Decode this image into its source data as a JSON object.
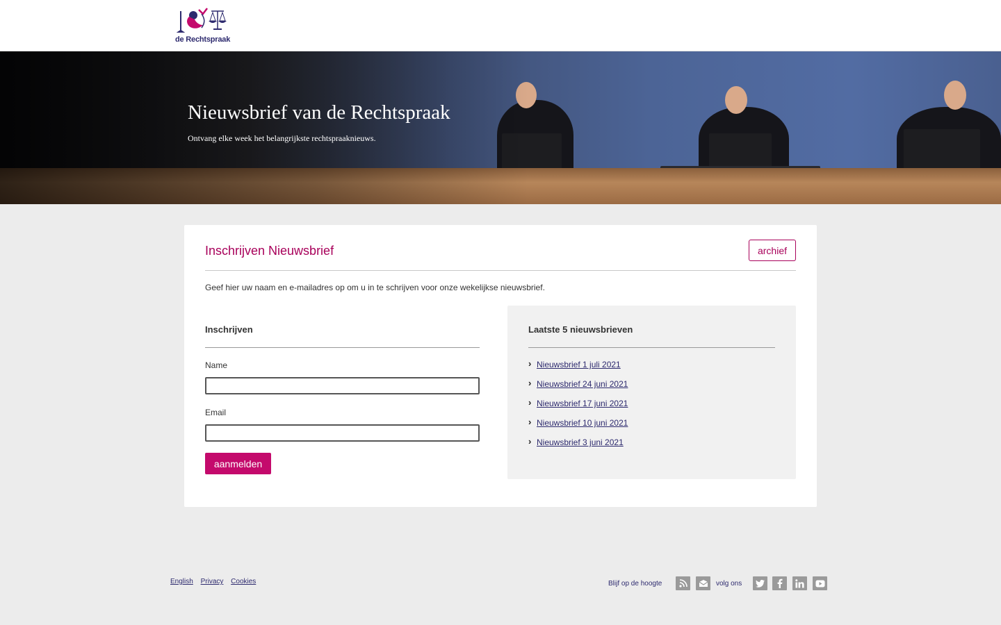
{
  "header": {
    "logo_text": "de Rechtspraak"
  },
  "hero": {
    "title": "Nieuwsbrief van de Rechtspraak",
    "subtitle": "Ontvang elke week het belangrijkste rechtspraaknieuws."
  },
  "card": {
    "title": "Inschrijven Nieuwsbrief",
    "archive_label": "archief",
    "intro": "Geef hier uw naam en e-mailadres op om u in te schrijven voor onze wekelijkse nieuwsbrief."
  },
  "form": {
    "title": "Inschrijven",
    "name_label": "Name",
    "name_value": "",
    "email_label": "Email",
    "email_value": "",
    "submit_label": "aanmelden"
  },
  "news": {
    "title": "Laatste 5 nieuwsbrieven",
    "items": [
      {
        "label": "Nieuwsbrief 1 juli 2021"
      },
      {
        "label": "Nieuwsbrief 24 juni 2021"
      },
      {
        "label": "Nieuwsbrief 17 juni 2021"
      },
      {
        "label": "Nieuwsbrief 10 juni 2021"
      },
      {
        "label": "Nieuwsbrief 3 juni 2021"
      }
    ]
  },
  "footer": {
    "links": [
      {
        "label": "English"
      },
      {
        "label": "Privacy"
      },
      {
        "label": "Cookies"
      }
    ],
    "stay_label": "Blijf op de hoogte",
    "follow_label": "volg ons",
    "icons": [
      "rss-icon",
      "mail-icon",
      "twitter-icon",
      "facebook-icon",
      "linkedin-icon",
      "youtube-icon"
    ]
  },
  "colors": {
    "brand": "#a8005a",
    "button": "#c40a6c",
    "link": "#2d2a6e",
    "background": "#ececec",
    "panel": "#f1f1f1"
  }
}
